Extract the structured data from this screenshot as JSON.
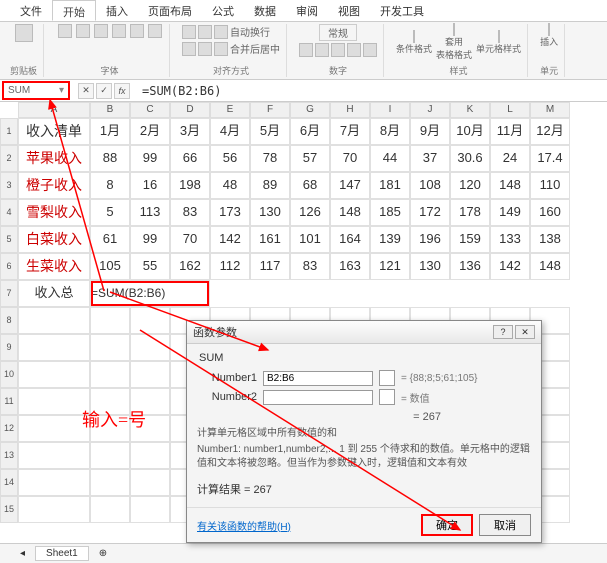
{
  "ribbon_tabs": [
    "文件",
    "开始",
    "插入",
    "页面布局",
    "公式",
    "数据",
    "审阅",
    "视图",
    "开发工具"
  ],
  "ribbon_tabs_active": 1,
  "ribbon_groups": {
    "clipboard": "剪贴板",
    "font": "字体",
    "align": "对齐方式",
    "number": "数字",
    "style": "样式",
    "cell": "单元"
  },
  "ribbon_labels": {
    "wrap": "自动换行",
    "merge": "合并后居中",
    "normal": "常规",
    "cond": "条件格式",
    "table": "套用\n表格格式",
    "cellstyle": "单元格样式",
    "insert": "插入"
  },
  "name_box": "SUM",
  "fx": {
    "cancel": "✕",
    "ok": "✓",
    "fx": "fx"
  },
  "formula": "=SUM(B2:B6)",
  "cols": [
    "A",
    "B",
    "C",
    "D",
    "E",
    "F",
    "G",
    "H",
    "I",
    "J",
    "K",
    "L",
    "M"
  ],
  "rows": [
    {
      "n": "1",
      "a": "收入清单",
      "v": [
        "1月",
        "2月",
        "3月",
        "4月",
        "5月",
        "6月",
        "7月",
        "8月",
        "9月",
        "10月",
        "11月",
        "12月"
      ]
    },
    {
      "n": "2",
      "a": "苹果收入",
      "red": true,
      "v": [
        "88",
        "99",
        "66",
        "56",
        "78",
        "57",
        "70",
        "44",
        "37",
        "30.6",
        "24",
        "17.4"
      ]
    },
    {
      "n": "3",
      "a": "橙子收入",
      "red": true,
      "v": [
        "8",
        "16",
        "198",
        "48",
        "89",
        "68",
        "147",
        "181",
        "108",
        "120",
        "148",
        "110"
      ]
    },
    {
      "n": "4",
      "a": "雪梨收入",
      "red": true,
      "v": [
        "5",
        "113",
        "83",
        "173",
        "130",
        "126",
        "148",
        "185",
        "172",
        "178",
        "149",
        "160"
      ]
    },
    {
      "n": "5",
      "a": "白菜收入",
      "red": true,
      "v": [
        "61",
        "99",
        "70",
        "142",
        "161",
        "101",
        "164",
        "139",
        "196",
        "159",
        "133",
        "138"
      ]
    },
    {
      "n": "6",
      "a": "生菜收入",
      "red": true,
      "v": [
        "105",
        "55",
        "162",
        "112",
        "117",
        "83",
        "163",
        "121",
        "130",
        "136",
        "142",
        "148"
      ]
    },
    {
      "n": "7",
      "a": "收入总",
      "b": "=SUM(B2:B6)",
      "v": [
        "",
        "",
        "",
        "",
        "",
        "",
        "",
        "",
        "",
        "",
        ""
      ]
    }
  ],
  "empty_rows": [
    "8",
    "9",
    "10",
    "11",
    "12",
    "13",
    "14",
    "15"
  ],
  "annotation": "输入=号",
  "dialog": {
    "title": "函数参数",
    "fname": "SUM",
    "args": [
      {
        "label": "Number1",
        "value": "B2:B6",
        "preview": "= {88;8;5;61;105}"
      },
      {
        "label": "Number2",
        "value": "",
        "preview": "= 数值"
      }
    ],
    "equals": "= 267",
    "desc1": "计算单元格区域中所有数值的和",
    "desc2": "Number1: number1,number2,... 1 到 255 个待求和的数值。单元格中的逻辑值和文本将被忽略。但当作为参数键入时，逻辑值和文本有效",
    "result_label": "计算结果 =",
    "result": "267",
    "help": "有关该函数的帮助(H)",
    "ok": "确定",
    "cancel": "取消"
  },
  "sheet_tab": "Sheet1",
  "chart_data": {
    "type": "table",
    "title": "收入清单",
    "categories": [
      "1月",
      "2月",
      "3月",
      "4月",
      "5月",
      "6月",
      "7月",
      "8月",
      "9月",
      "10月",
      "11月",
      "12月"
    ],
    "series": [
      {
        "name": "苹果收入",
        "values": [
          88,
          99,
          66,
          56,
          78,
          57,
          70,
          44,
          37,
          30.6,
          24,
          17.4
        ]
      },
      {
        "name": "橙子收入",
        "values": [
          8,
          16,
          198,
          48,
          89,
          68,
          147,
          181,
          108,
          120,
          148,
          110
        ]
      },
      {
        "name": "雪梨收入",
        "values": [
          5,
          113,
          83,
          173,
          130,
          126,
          148,
          185,
          172,
          178,
          149,
          160
        ]
      },
      {
        "name": "白菜收入",
        "values": [
          61,
          99,
          70,
          142,
          161,
          101,
          164,
          139,
          196,
          159,
          133,
          138
        ]
      },
      {
        "name": "生菜收入",
        "values": [
          105,
          55,
          162,
          112,
          117,
          83,
          163,
          121,
          130,
          136,
          142,
          148
        ]
      }
    ],
    "sum_B2_B6": 267
  }
}
